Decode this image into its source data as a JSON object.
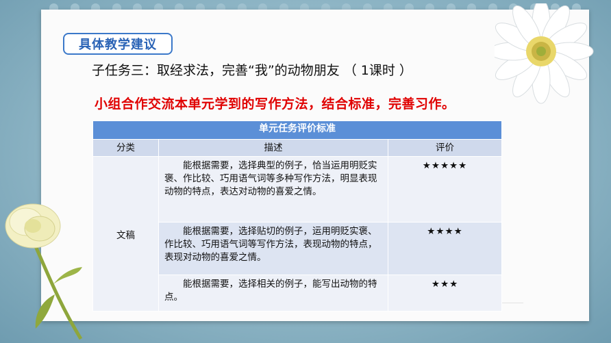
{
  "header": {
    "tag_label": "具体教学建议",
    "subtask_title": "子任务三：取经求法，完善“我”的动物朋友 （ 1课时 ）",
    "instruction": "小组合作交流本单元学到的写作方法，结合标准，完善习作。"
  },
  "table": {
    "title": "单元任务评价标准",
    "columns": [
      "分类",
      "描述",
      "评价"
    ],
    "category": "文稿",
    "rows": [
      {
        "description": "能根据需要，选择典型的例子，恰当运用明贬实褒、作比较、巧用语气词等多种写作方法，明显表现动物的特点，表达对动物的喜爱之情。",
        "rating": "★★★★★"
      },
      {
        "description": "能根据需要，选择贴切的例子，运用明贬实褒、作比较、巧用语气词等写作方法，表现动物的特点，表现对动物的喜爱之情。",
        "rating": "★★★★"
      },
      {
        "description": "能根据需要，选择相关的例子，能写出动物的特点。",
        "rating": "★★★"
      }
    ]
  },
  "colors": {
    "background": "#8fb6c6",
    "tag_border": "#3b78c9",
    "instruction_red": "#e00000",
    "table_header": "#5b8fd7"
  },
  "decorations": {
    "top_right": "white-daisy-flower",
    "bottom_left": "cream-lisianthus-flower"
  }
}
